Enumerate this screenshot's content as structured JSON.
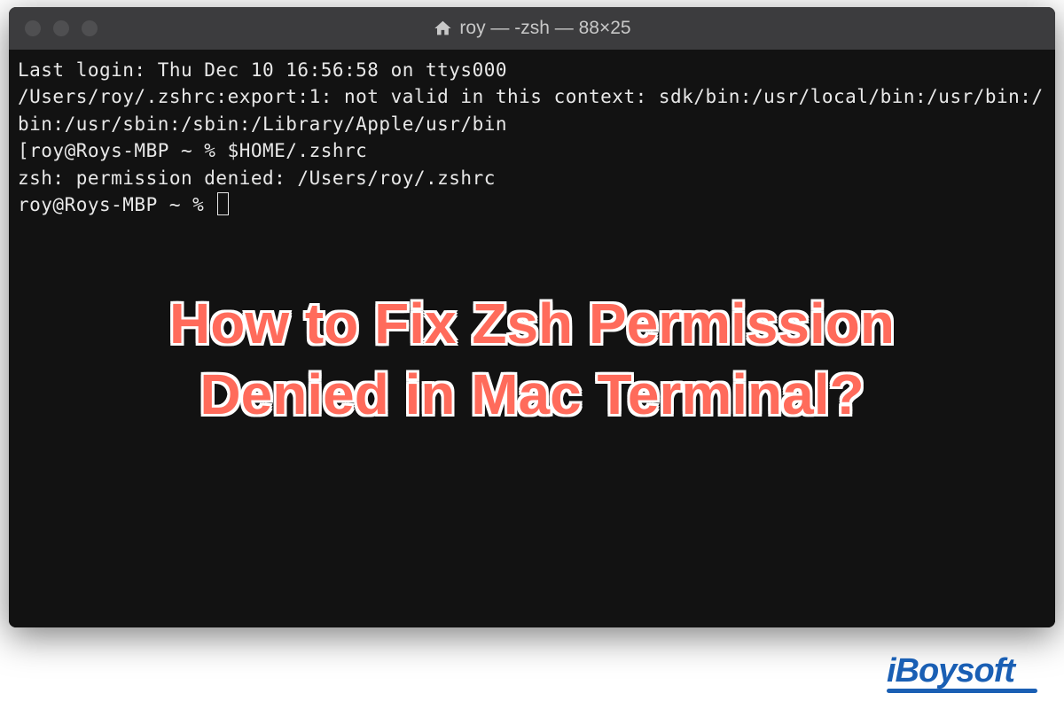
{
  "window": {
    "title": "roy — -zsh — 88×25"
  },
  "terminal": {
    "line1": "Last login: Thu Dec 10 16:56:58 on ttys000",
    "line2": "/Users/roy/.zshrc:export:1: not valid in this context: sdk/bin:/usr/local/bin:/usr/bin:/",
    "line3": "bin:/usr/sbin:/sbin:/Library/Apple/usr/bin",
    "line4_prompt": "[roy@Roys-MBP ~ % ",
    "line4_cmd": "$HOME/.zshrc",
    "line5": "zsh: permission denied: /Users/roy/.zshrc",
    "line6_prompt": "roy@Roys-MBP ~ % "
  },
  "overlay": {
    "title_line1": "How to Fix Zsh Permission",
    "title_line2": "Denied in Mac Terminal?"
  },
  "brand": {
    "name": "iBoysoft"
  }
}
